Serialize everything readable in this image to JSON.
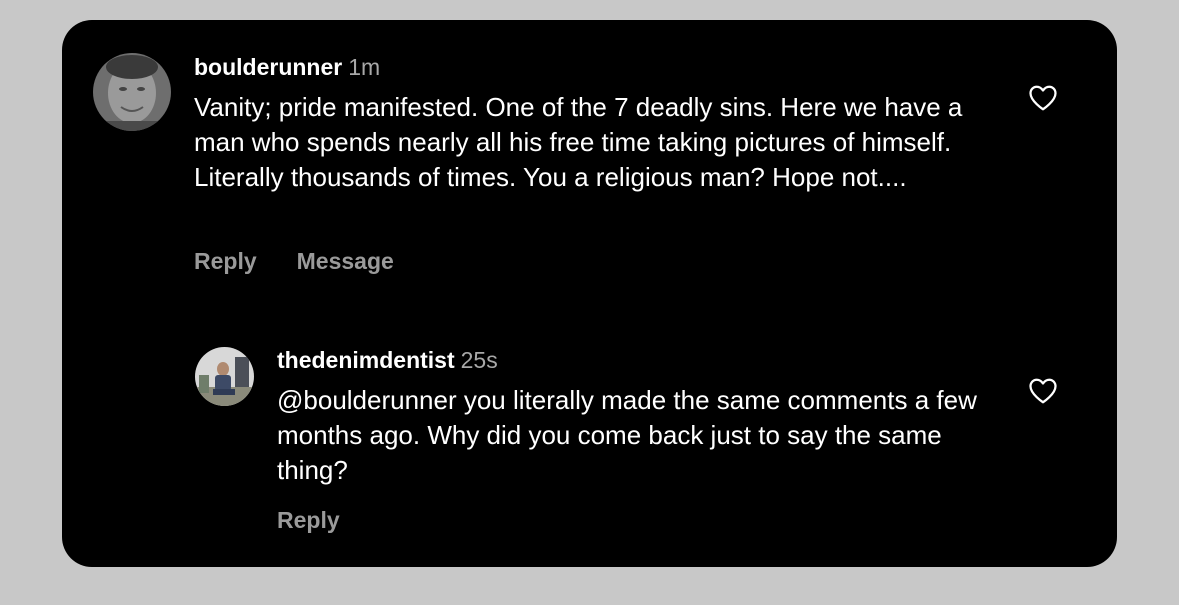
{
  "comments": [
    {
      "username": "boulderunner",
      "time": "1m",
      "text": "Vanity; pride manifested. One of the 7 deadly sins. Here we have a man who spends nearly all his free time taking pictures of himself. Literally thousands of times. You a religious man? Hope not....",
      "reply_label": "Reply",
      "message_label": "Message",
      "avatar_icon": "user-avatar",
      "like_icon": "heart-outline-icon"
    }
  ],
  "replies": [
    {
      "username": "thedenimdentist",
      "time": "25s",
      "text": "@boulderunner you literally made the same comments a few months ago. Why did you come back just to say the same thing?",
      "reply_label": "Reply",
      "avatar_icon": "user-avatar",
      "like_icon": "heart-outline-icon"
    }
  ],
  "colors": {
    "page_background": "#c8c8c8",
    "card_background": "#000000",
    "text_primary": "#ffffff",
    "text_secondary": "#a8a8a8"
  }
}
